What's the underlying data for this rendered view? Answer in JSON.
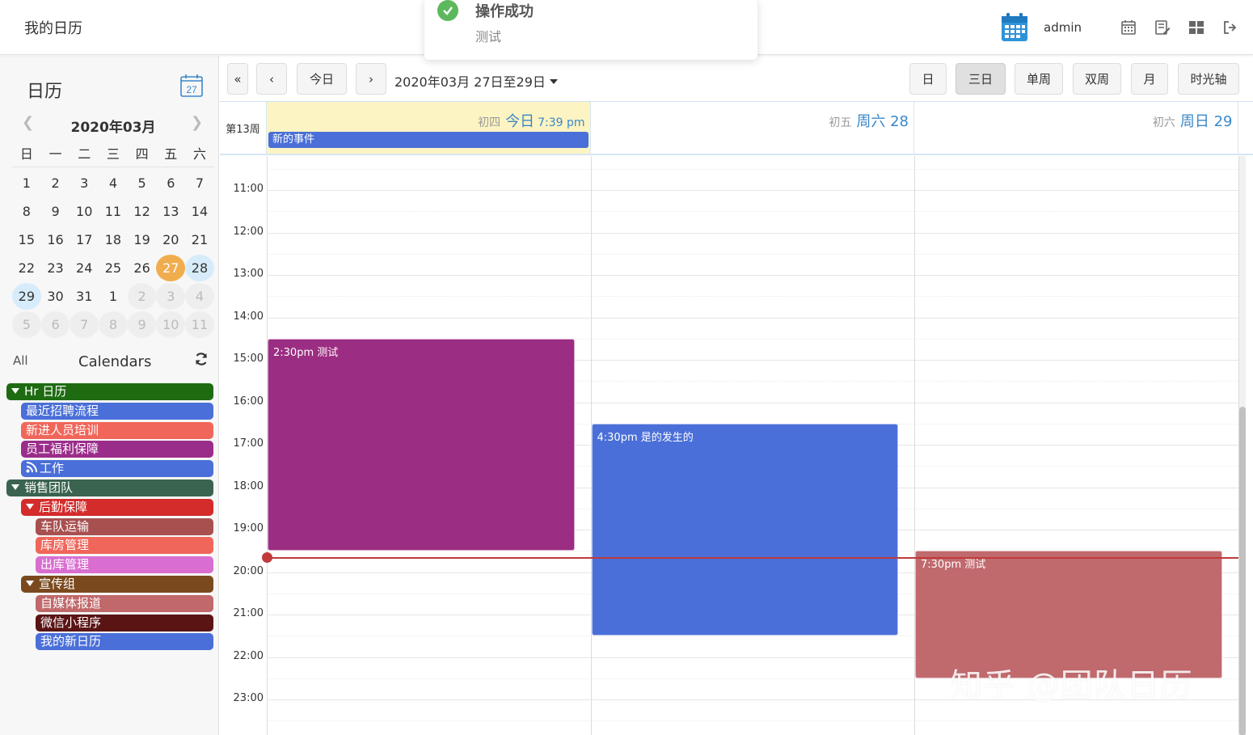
{
  "header": {
    "app_title": "我的日历",
    "username": "admin",
    "icons": [
      "calendar-logo-icon",
      "calendar-icon",
      "edit-list-icon",
      "grid-icon",
      "logout-icon"
    ]
  },
  "toast": {
    "title": "操作成功",
    "message": "测试",
    "icon": "check-circle-icon",
    "color": "#5cb85c"
  },
  "sidebar": {
    "title": "日历",
    "cal_icon_day": "27",
    "mini_calendar": {
      "month_label": "2020年03月",
      "weekdays": [
        "日",
        "一",
        "二",
        "三",
        "四",
        "五",
        "六"
      ],
      "weeks": [
        [
          "1",
          "2",
          "3",
          "4",
          "5",
          "6",
          "7"
        ],
        [
          "8",
          "9",
          "10",
          "11",
          "12",
          "13",
          "14"
        ],
        [
          "15",
          "16",
          "17",
          "18",
          "19",
          "20",
          "21"
        ],
        [
          "22",
          "23",
          "24",
          "25",
          "26",
          "27",
          "28"
        ],
        [
          "29",
          "30",
          "31",
          "1",
          "2",
          "3",
          "4"
        ],
        [
          "5",
          "6",
          "7",
          "8",
          "9",
          "10",
          "11"
        ]
      ],
      "today": "27",
      "selected": [
        "28",
        "29"
      ]
    },
    "calendars_header": {
      "all_label": "All",
      "title": "Calendars"
    },
    "calendars": [
      {
        "label": "Hr 日历",
        "color": "#1e6b12",
        "group": true
      },
      {
        "label": "最近招聘流程",
        "color": "#4a6fd8"
      },
      {
        "label": "新进人员培训",
        "color": "#f0665a"
      },
      {
        "label": "员工福利保障",
        "color": "#9b2d8a"
      },
      {
        "label": "工作",
        "color": "#4a6fd8",
        "rss": true
      },
      {
        "label": "销售团队",
        "color": "#3a6350",
        "group": true
      },
      {
        "label": "后勤保障",
        "color": "#d42b2b",
        "group": true
      },
      {
        "label": "车队运输",
        "color": "#a85050"
      },
      {
        "label": "库房管理",
        "color": "#f0665a"
      },
      {
        "label": "出库管理",
        "color": "#d96ed0"
      },
      {
        "label": "宣传组",
        "color": "#7a4a1e",
        "group": true
      },
      {
        "label": "自媒体报道",
        "color": "#c0686a"
      },
      {
        "label": "微信小程序",
        "color": "#5a1414"
      },
      {
        "label": "我的新日历",
        "color": "#4a6fd8"
      }
    ]
  },
  "toolbar": {
    "today_label": "今日",
    "range_label": "2020年03月 27日至29日",
    "views": [
      "日",
      "三日",
      "单周",
      "双周",
      "月",
      "时光轴"
    ],
    "active_view": "三日"
  },
  "grid": {
    "week_label": "第13周",
    "days": [
      {
        "lunar": "初四",
        "label": "今日",
        "time": "7:39 pm",
        "today": true
      },
      {
        "lunar": "初五",
        "label": "周六 28"
      },
      {
        "lunar": "初六",
        "label": "周日 29"
      }
    ],
    "allday_event": {
      "title": "新的事件",
      "color": "#4a6fd8"
    },
    "hours": [
      "11:00",
      "12:00",
      "13:00",
      "14:00",
      "15:00",
      "16:00",
      "17:00",
      "18:00",
      "19:00",
      "20:00",
      "21:00",
      "22:00",
      "23:00"
    ],
    "events": [
      {
        "day": 0,
        "start": 14.5,
        "end": 19.5,
        "title": "2:30pm 测试",
        "color": "#9b2d82"
      },
      {
        "day": 1,
        "start": 16.5,
        "end": 21.5,
        "title": "4:30pm 是的发生的",
        "color": "#4a6fd8"
      },
      {
        "day": 2,
        "start": 19.5,
        "end": 22.5,
        "title": "7:30pm 测试",
        "color": "#c06a6e"
      }
    ],
    "now_hour": 19.65,
    "now_color": "#c0393b"
  },
  "watermark": "知乎 @团队日历"
}
